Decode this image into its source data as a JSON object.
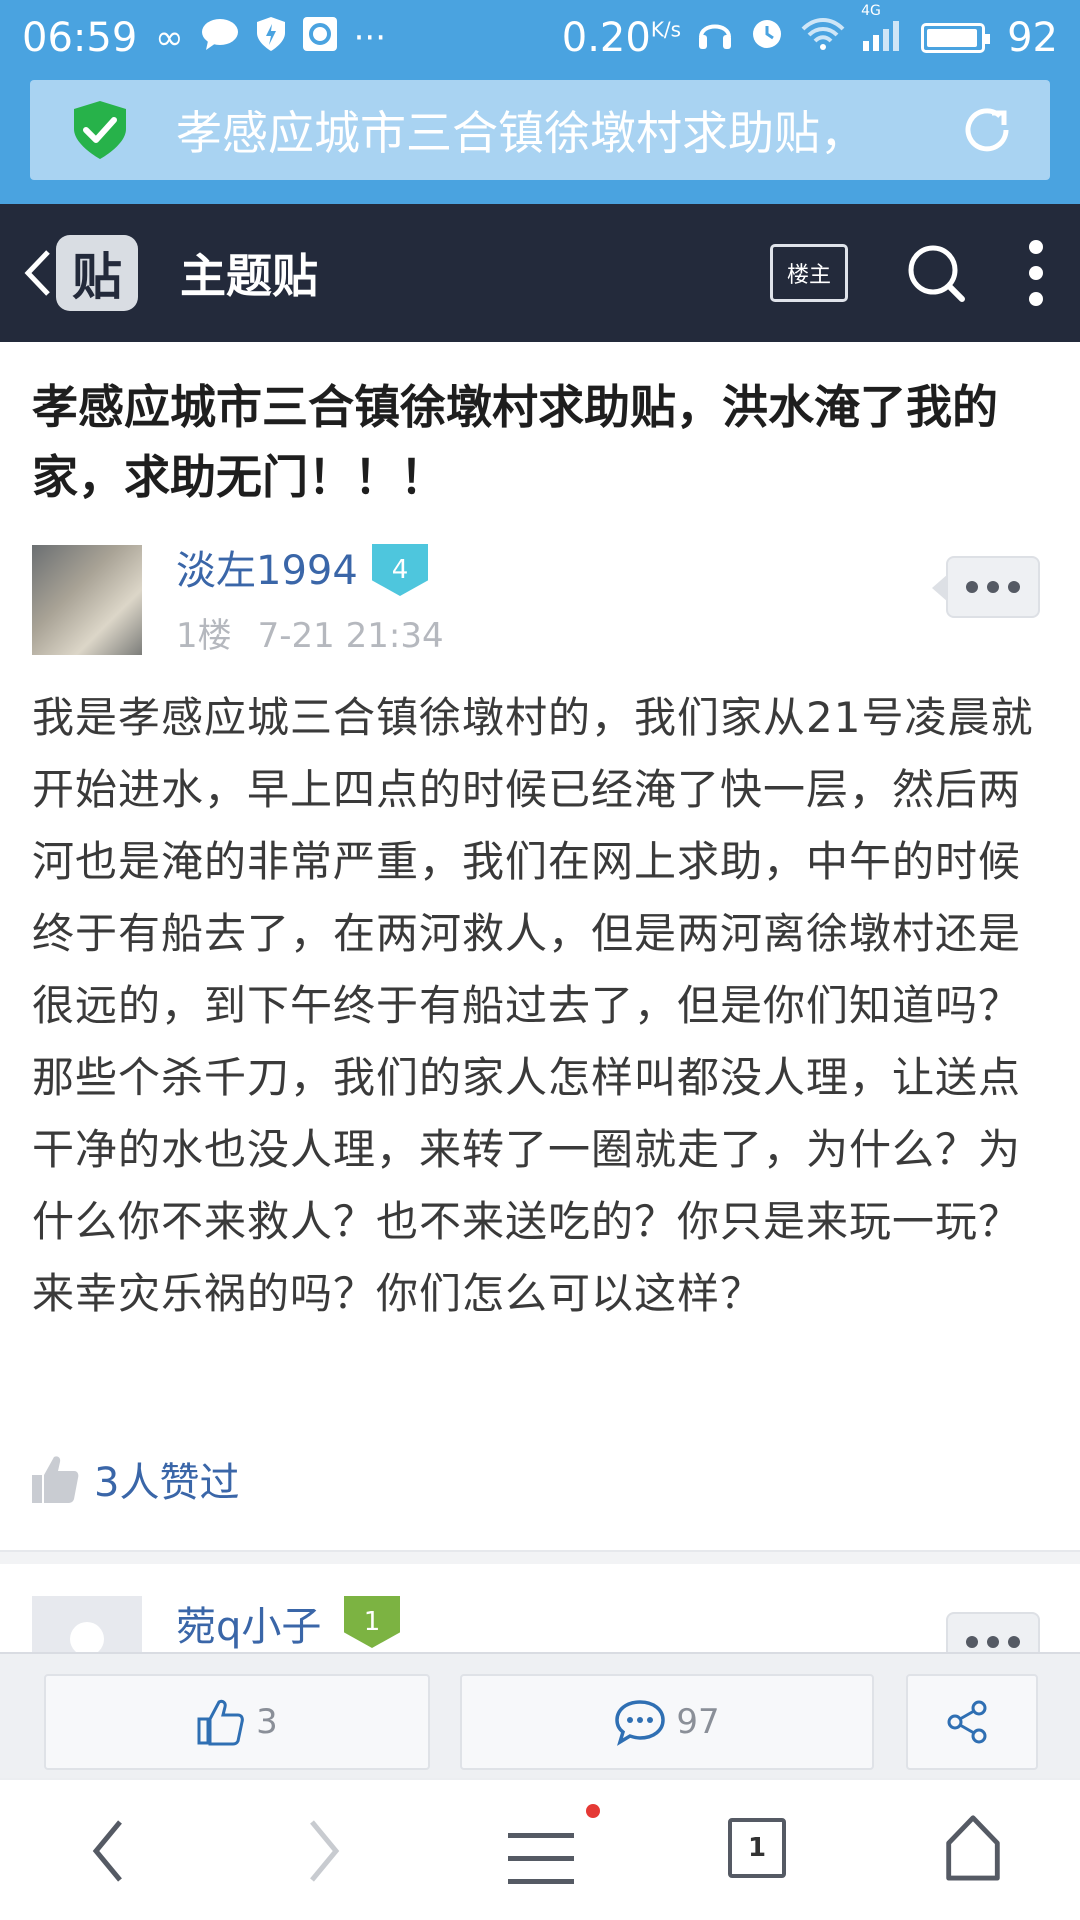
{
  "status_bar": {
    "time": "06:59",
    "network_speed": "0.20",
    "network_unit": "K/s",
    "network_type": "4G",
    "battery": "92"
  },
  "url_bar": {
    "text": "孝感应城市三合镇徐墩村求助贴，"
  },
  "nav": {
    "logo_text": "贴",
    "title": "主题贴",
    "louzhu_label": "楼主"
  },
  "post": {
    "title": "孝感应城市三合镇徐墩村求助贴，洪水淹了我的家，求助无门！！！",
    "author": "淡左1994",
    "level": "4",
    "floor": "1楼",
    "time": "7-21 21:34",
    "body": "我是孝感应城三合镇徐墩村的，我们家从21号凌晨就开始进水，早上四点的时候已经淹了快一层，然后两河也是淹的非常严重，我们在网上求助，中午的时候终于有船去了，在两河救人，但是两河离徐墩村还是很远的，到下午终于有船过去了，但是你们知道吗？那些个杀千刀，我们的家人怎样叫都没人理，让送点干净的水也没人理，来转了一圈就走了，为什么？为什么你不来救人？也不来送吃的？你只是来玩一玩？来幸灾乐祸的吗？你们怎么可以这样？",
    "likes_text": "3人赞过"
  },
  "reply": {
    "author": "菀q小子",
    "level": "1"
  },
  "action_bar": {
    "like_count": "3",
    "comment_count": "97"
  },
  "browser_bar": {
    "tab_count": "1"
  },
  "colors": {
    "status_bg": "#4aa3e0",
    "nav_bg": "#232a3b",
    "link_blue": "#3a66a8",
    "level_badge": "#4ec6dd",
    "reply_badge": "#7cb342"
  }
}
